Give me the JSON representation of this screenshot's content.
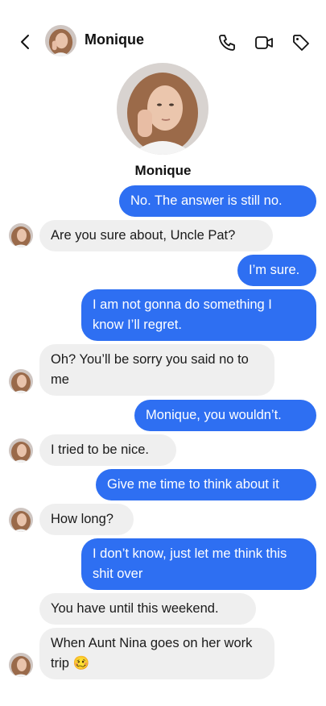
{
  "header": {
    "contact_name": "Monique"
  },
  "profile": {
    "name": "Monique"
  },
  "messages": [
    {
      "side": "out",
      "text": "No. The answer is still no."
    },
    {
      "side": "in",
      "text": "Are you sure about, Uncle Pat?"
    },
    {
      "side": "out",
      "text": "I’m sure."
    },
    {
      "side": "out",
      "text": "I am not gonna do something I know I’ll regret."
    },
    {
      "side": "in",
      "text": "Oh? You’ll be sorry you said no to me"
    },
    {
      "side": "out",
      "text": "Monique, you wouldn’t."
    },
    {
      "side": "in",
      "text": "I tried to be nice."
    },
    {
      "side": "out",
      "text": "Give me time to think about it"
    },
    {
      "side": "in",
      "text": "How long?"
    },
    {
      "side": "out",
      "text": "I don’t know, just let me think this shit over"
    },
    {
      "side": "in",
      "text": "You have until this weekend."
    },
    {
      "side": "in",
      "text": "When Aunt Nina goes on her work trip 🥴"
    }
  ],
  "icons": {
    "back": "chevron-left-icon",
    "call": "phone-icon",
    "video": "video-camera-icon",
    "tag": "tag-icon"
  },
  "colors": {
    "outgoing_bubble": "#2e6ff2",
    "incoming_bubble": "#efefef",
    "background": "#ffffff"
  }
}
